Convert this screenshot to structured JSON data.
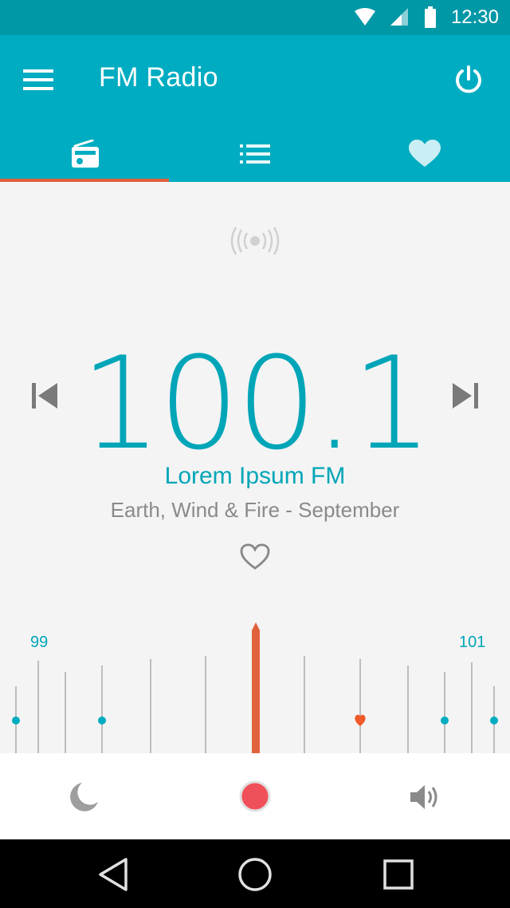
{
  "status_bar": {
    "time": "12:30"
  },
  "app_bar": {
    "title": "FM Radio"
  },
  "tabs": [
    {
      "name": "radio",
      "selected": true
    },
    {
      "name": "station-list",
      "selected": false
    },
    {
      "name": "favorites",
      "selected": false
    }
  ],
  "player": {
    "frequency": "100.1",
    "station_name": "Lorem Ipsum FM",
    "now_playing": "Earth, Wind & Fire - September"
  },
  "dial": {
    "left_label": "99",
    "right_label": "101"
  },
  "colors": {
    "primary": "#00acc1",
    "primary_dark": "#0097a7",
    "accent": "#e0623a",
    "record": "#f0505a"
  },
  "icons": [
    "menu-icon",
    "power-icon",
    "radio-icon",
    "list-icon",
    "heart-icon",
    "signal-icon",
    "previous-icon",
    "next-icon",
    "favorite-outline-icon",
    "sleep-moon-icon",
    "record-icon",
    "volume-icon",
    "back-icon",
    "home-icon",
    "recents-icon"
  ]
}
